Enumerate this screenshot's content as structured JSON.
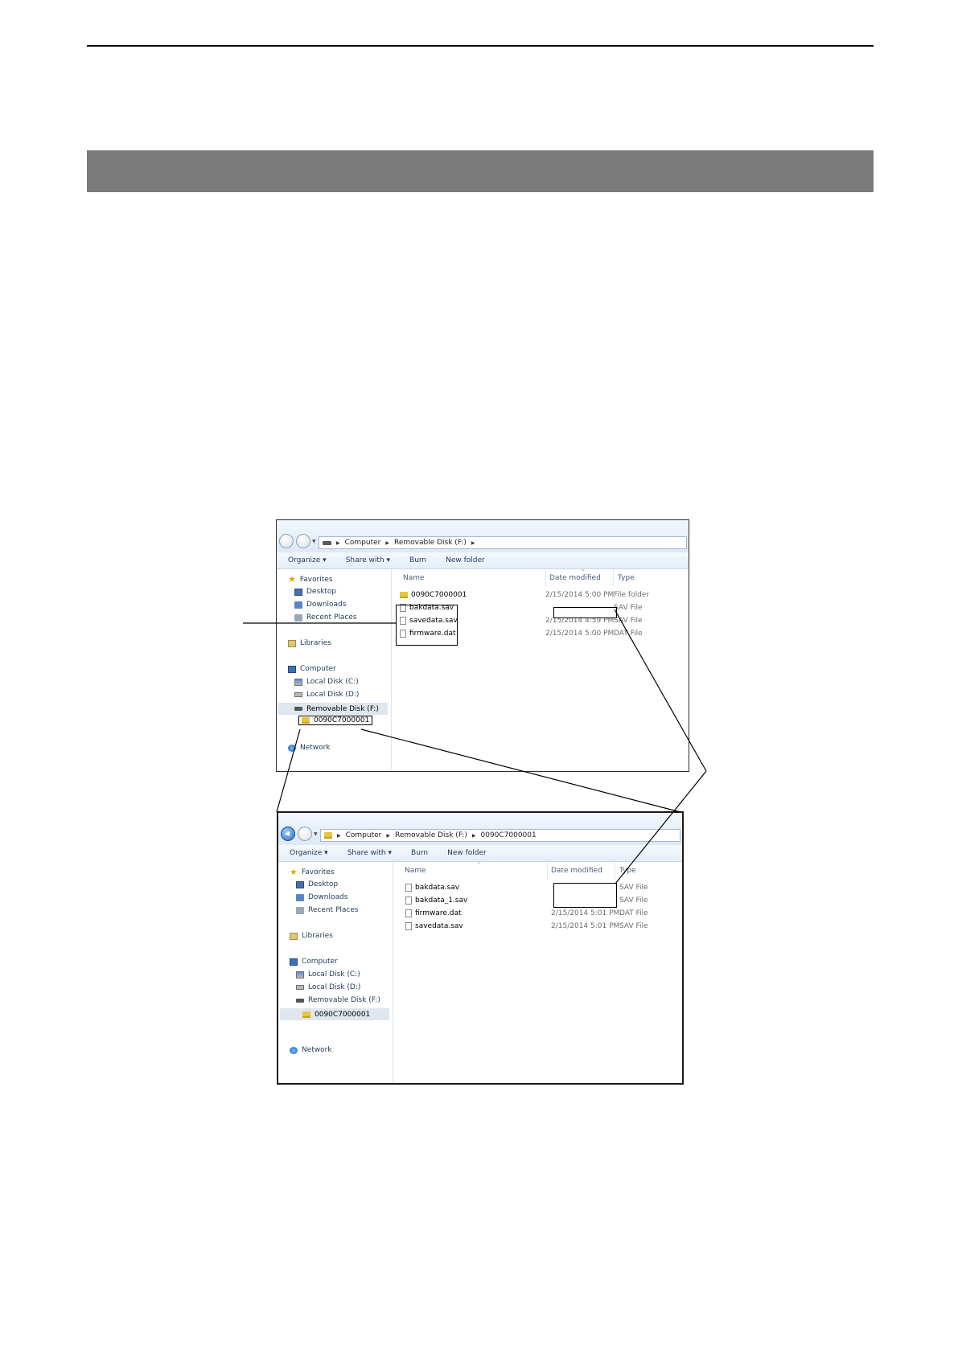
{
  "window_top": {
    "address": {
      "crumbs": [
        "Computer",
        "Removable Disk (F:)"
      ]
    },
    "toolbar": {
      "organize": "Organize ▾",
      "share_with": "Share with ▾",
      "burn": "Burn",
      "new_folder": "New folder"
    },
    "columns": {
      "name": "Name",
      "date_modified": "Date modified",
      "type": "Type"
    },
    "sidebar": {
      "favorites": "Favorites",
      "desktop": "Desktop",
      "downloads": "Downloads",
      "recent_places": "Recent Places",
      "libraries": "Libraries",
      "computer": "Computer",
      "local_c": "Local Disk (C:)",
      "local_d": "Local Disk (D:)",
      "removable_f": "Removable Disk (F:)",
      "folder": "0090C7000001",
      "network": "Network"
    },
    "files": [
      {
        "name": "0090C7000001",
        "date": "2/15/2014 5:00 PM",
        "type": "File folder"
      },
      {
        "name": "bakdata.sav",
        "date": "",
        "type": "SAV File"
      },
      {
        "name": "savedata.sav",
        "date": "2/15/2014 4:59 PM",
        "type": "SAV File"
      },
      {
        "name": "firmware.dat",
        "date": "2/15/2014 5:00 PM",
        "type": "DAT File"
      }
    ]
  },
  "window_bottom": {
    "address": {
      "crumbs": [
        "Computer",
        "Removable Disk (F:)",
        "0090C7000001"
      ]
    },
    "toolbar": {
      "organize": "Organize ▾",
      "share_with": "Share with ▾",
      "burn": "Burn",
      "new_folder": "New folder"
    },
    "columns": {
      "name": "Name",
      "date_modified": "Date modified",
      "type": "Type"
    },
    "sidebar": {
      "favorites": "Favorites",
      "desktop": "Desktop",
      "downloads": "Downloads",
      "recent_places": "Recent Places",
      "libraries": "Libraries",
      "computer": "Computer",
      "local_c": "Local Disk (C:)",
      "local_d": "Local Disk (D:)",
      "removable_f": "Removable Disk (F:)",
      "folder": "0090C7000001",
      "network": "Network"
    },
    "files": [
      {
        "name": "bakdata.sav",
        "date": "",
        "type": "SAV File"
      },
      {
        "name": "bakdata_1.sav",
        "date": "",
        "type": "SAV File"
      },
      {
        "name": "firmware.dat",
        "date": "2/15/2014 5:01 PM",
        "type": "DAT File"
      },
      {
        "name": "savedata.sav",
        "date": "2/15/2014 5:01 PM",
        "type": "SAV File"
      }
    ]
  },
  "colors": {
    "section_bar": "#7a7a7a",
    "explorer_chrome": "#dde9f6",
    "link_text": "#1e395b"
  }
}
